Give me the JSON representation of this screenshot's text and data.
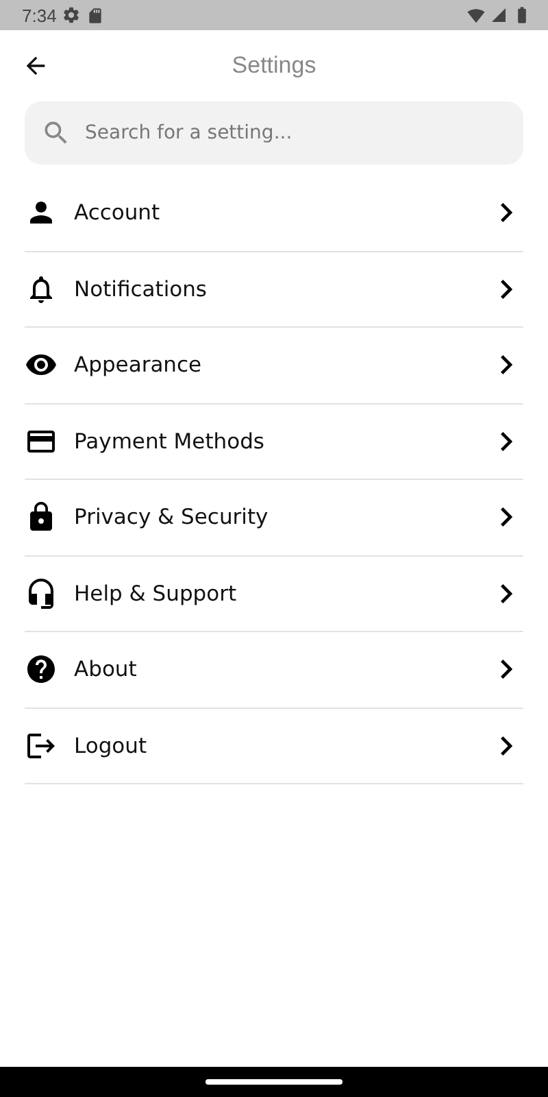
{
  "status_bar": {
    "time": "7:34"
  },
  "header": {
    "title": "Settings"
  },
  "search": {
    "placeholder": "Search for a setting..."
  },
  "items": [
    {
      "label": "Account"
    },
    {
      "label": "Notifications"
    },
    {
      "label": "Appearance"
    },
    {
      "label": "Payment Methods"
    },
    {
      "label": "Privacy & Security"
    },
    {
      "label": "Help & Support"
    },
    {
      "label": "About"
    },
    {
      "label": "Logout"
    }
  ]
}
